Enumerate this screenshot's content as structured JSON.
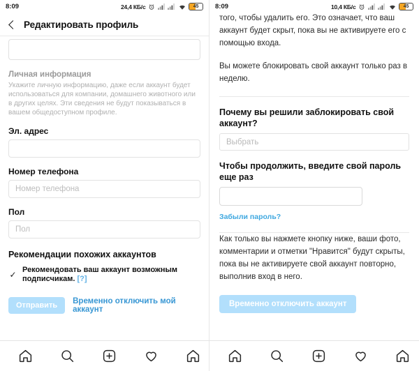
{
  "left": {
    "status_bar": {
      "time": "8:09",
      "network_speed": "24,4 КБ/c",
      "battery_level": "45",
      "alarm_icon": "alarm-icon",
      "signal1_icon": "signal-bars-icon",
      "signal2_icon": "signal-bars-icon",
      "wifi_icon": "wifi-icon"
    },
    "appbar": {
      "back_icon": "back-chevron-icon",
      "title": "Редактировать профиль"
    },
    "personal_section": {
      "title": "Личная информация",
      "description": "Укажите личную информацию, даже если аккаунт будет использоваться для компании, домашнего животного или в других целях. Эти сведения не будут показываться в вашем общедоступном профиле."
    },
    "fields": [
      {
        "label": "Эл. адрес",
        "value": "",
        "placeholder": ""
      },
      {
        "label": "Номер телефона",
        "value": "",
        "placeholder": "Номер телефона"
      },
      {
        "label": "Пол",
        "value": "",
        "placeholder": "Пол"
      }
    ],
    "suggestions": {
      "title": "Рекомендации похожих аккаунтов",
      "checkbox_checked": true,
      "check_glyph": "✓",
      "checkbox_label": "Рекомендовать ваш аккаунт возможным подписчикам.",
      "help_badge": "[?]"
    },
    "actions": {
      "submit_label": "Отправить",
      "deactivate_link": "Временно отключить мой аккаунт"
    }
  },
  "right": {
    "status_bar": {
      "time": "8:09",
      "network_speed": "10,4 КБ/c",
      "battery_level": "45",
      "alarm_icon": "alarm-icon",
      "signal1_icon": "signal-bars-icon",
      "signal2_icon": "signal-bars-icon",
      "wifi_icon": "wifi-icon"
    },
    "paragraphs": [
      "того, чтобы удалить его. Это означает, что ваш аккаунт будет скрыт, пока вы не активируете его с помощью входа.",
      "Вы можете блокировать свой аккаунт только раз в неделю."
    ],
    "reason": {
      "label": "Почему вы решили заблокировать свой аккаунт?",
      "select_value": "Выбрать"
    },
    "password": {
      "label": "Чтобы продолжить, введите свой пароль еще раз",
      "value": "",
      "forgot_link": "Забыли пароль?"
    },
    "notice": "Как только вы нажмете кнопку ниже, ваши фото, комментарии и отметки \"Нравится\" будут скрыты, пока вы не активируете свой аккаунт повторно, выполнив вход в него.",
    "deactivate_button": "Временно отключить аккаунт"
  },
  "bottom_nav": {
    "items": [
      {
        "icon": "home-icon",
        "name": "nav-home"
      },
      {
        "icon": "search-icon",
        "name": "nav-search"
      },
      {
        "icon": "plus-square-icon",
        "name": "nav-add"
      },
      {
        "icon": "heart-icon",
        "name": "nav-activity"
      },
      {
        "icon": "home-icon",
        "name": "nav-profile-clipped"
      }
    ]
  },
  "colors": {
    "accent": "#3897d4",
    "button_disabled": "#b2dffc",
    "battery": "#f5a623"
  }
}
